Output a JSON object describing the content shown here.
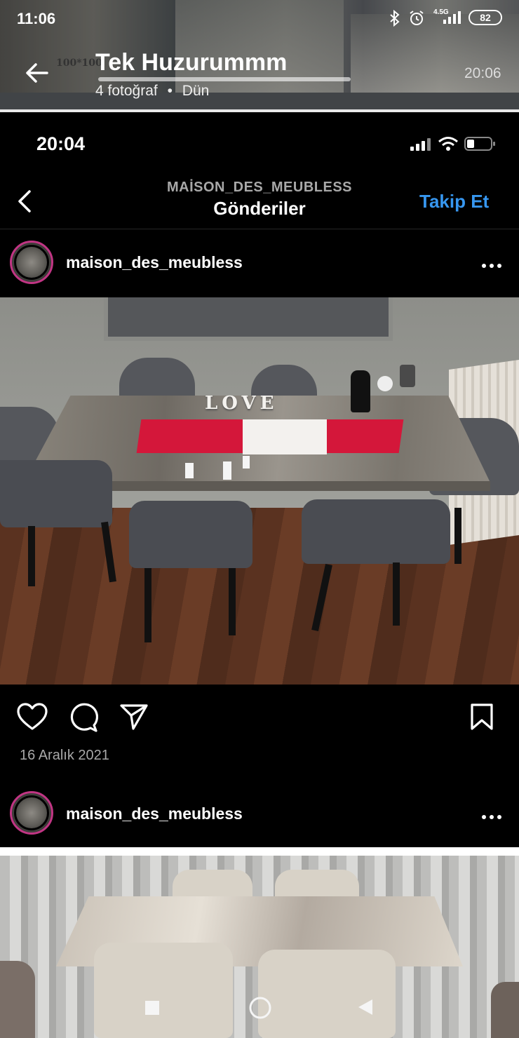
{
  "outer_status": {
    "time": "11:06",
    "network": "4.5G",
    "battery": "82"
  },
  "story": {
    "title": "Tek Huzurummm",
    "subtitle_count": "4 fotoğraf",
    "subtitle_sep": "•",
    "subtitle_when": "Dün",
    "time_right": "20:06",
    "overlay_text": "100*100"
  },
  "inner_status": {
    "time": "20:04"
  },
  "ig_header": {
    "account": "MAİSON_DES_MEUBLESS",
    "title": "Gönderiler",
    "follow": "Takip Et"
  },
  "posts": [
    {
      "username": "maison_des_meubless",
      "date": "16 Aralık 2021"
    },
    {
      "username": "maison_des_meubless"
    }
  ],
  "photo1": {
    "love_text": "LOVE"
  },
  "colors": {
    "follow_blue": "#3797f0",
    "runner_red": "#d4173a",
    "avatar_ring": "#c13584"
  },
  "icons": [
    "back-arrow-icon",
    "bluetooth-icon",
    "alarm-icon",
    "signal-icon",
    "battery-icon",
    "wifi-icon",
    "chevron-left-icon",
    "more-icon",
    "heart-icon",
    "comment-icon",
    "send-icon",
    "bookmark-icon",
    "nav-square-icon",
    "nav-circle-icon",
    "nav-back-icon"
  ]
}
